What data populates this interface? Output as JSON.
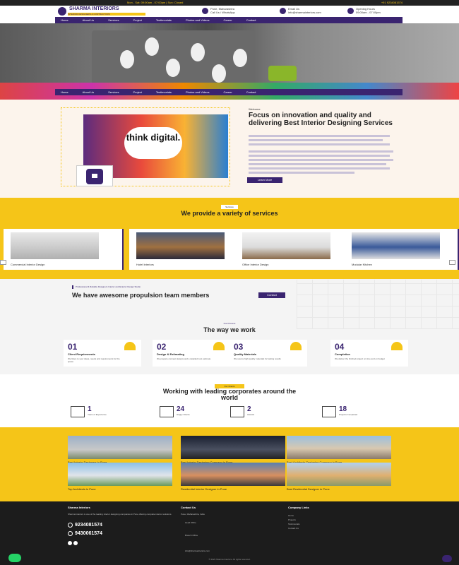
{
  "topbar": {
    "left": "Mon - Sat: 09:00am - 07:00pm | Sun: Closed",
    "right": "+91 9234081574"
  },
  "header": {
    "brand": "SHARMA INTERIORS",
    "tagline": "INTERIOR DESIGNERS & CONTRACTORS",
    "info": [
      {
        "title": "Pune, Maharashtra",
        "sub": "Call Us / WhatsApp"
      },
      {
        "title": "Email Us",
        "sub": "info@sharmainteriors.com"
      },
      {
        "title": "Opening Hours",
        "sub": "09:00am - 07:00pm"
      }
    ]
  },
  "nav": [
    "Home",
    "About Us",
    "Services",
    "Project",
    "Testimonials",
    "Photos and Videos",
    "Career",
    "Contact"
  ],
  "about": {
    "tag": "Welcome",
    "title": "Focus on innovation and quality and delivering Best Interior Designing Services",
    "image_text": "think digital.",
    "button": "Learn More"
  },
  "services": {
    "tag": "Services",
    "title": "We provide a variety of services",
    "items": [
      "Commercial Interior Design",
      "Hotel Interiors",
      "Office Interior Design",
      "Modular Kitchen"
    ]
  },
  "team": {
    "tag": "Professional & Reliable Designers Interior and Exterior Design Studio",
    "title": "We have awesome propulsion team members",
    "button": "Contact"
  },
  "way": {
    "tag": "Our Process",
    "title": "The way we work",
    "steps": [
      {
        "num": "01",
        "title": "Client Requirements",
        "desc": "We listen to your ideas, needs and requirements for the space"
      },
      {
        "num": "02",
        "title": "Design & Estimating",
        "desc": "We prepare concept designs and a detailed cost estimate"
      },
      {
        "num": "03",
        "title": "Quality Materials",
        "desc": "We source high quality materials for lasting results"
      },
      {
        "num": "04",
        "title": "Completion",
        "desc": "We deliver the finished project on time and on budget"
      }
    ]
  },
  "clients": {
    "tag": "Our Clients",
    "title": "Working with leading corporates around the world",
    "stats": [
      {
        "value": "1",
        "label": "Years of Experience"
      },
      {
        "value": "24",
        "label": "Happy Clients"
      },
      {
        "value": "2",
        "label": "Awards"
      },
      {
        "value": "18",
        "label": "Projects Completed"
      }
    ]
  },
  "projects": [
    "Best Interior Designers in Pune",
    "Best Interior Designing Company in Pune",
    "Best Architects Designing Company in Pune",
    "Top Architects in Pune",
    "Residential Interior Designer in Pune",
    "Best Residential Designer in Pune"
  ],
  "footer": {
    "brand": "Sharma Interiors",
    "about": "Sharma Interiors is one of the leading interior designing companies in Pune offering complete interior solutions.",
    "phones": [
      "9234081574",
      "9430061574"
    ],
    "contact_title": "Contact Us",
    "contact_lines": [
      "Pune, Maharashtra, India",
      "Head Office",
      "Branch Office",
      "info@sharmainteriors.com"
    ],
    "links_title": "Company Links",
    "links": [
      "Home",
      "Projects",
      "Testimonials",
      "Contact Us"
    ],
    "copyright": "© 2023 Sharma Interiors. All rights reserved."
  }
}
